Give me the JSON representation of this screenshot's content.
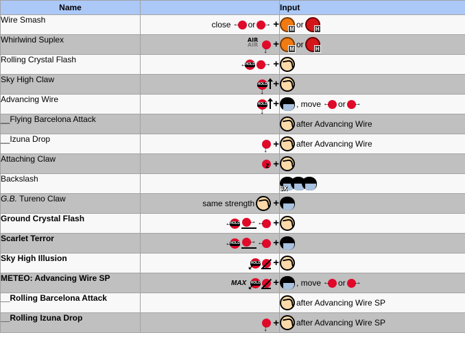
{
  "table": {
    "headers": {
      "name": "Name",
      "direction": "",
      "input": "Input"
    },
    "rows": [
      {
        "name": "Wire Smash",
        "style": "normal",
        "direction": {
          "prefix": "close",
          "sequence": [
            "back",
            "or",
            "forward"
          ]
        },
        "input": {
          "buttons": [
            "punch-medium",
            "or",
            "punch-heavy"
          ],
          "suffix": ""
        }
      },
      {
        "name": "Whirlwind Suplex",
        "style": "normal",
        "direction": {
          "prefix": "AIR",
          "sequence": [
            "down"
          ]
        },
        "input": {
          "buttons": [
            "punch-medium",
            "or",
            "punch-heavy"
          ],
          "suffix": ""
        }
      },
      {
        "name": "Rolling Crystal Flash",
        "style": "normal",
        "direction": {
          "prefix": "",
          "sequence": [
            "hold-back",
            "forward"
          ]
        },
        "input": {
          "buttons": [
            "punch"
          ],
          "suffix": ""
        }
      },
      {
        "name": "Sky High Claw",
        "style": "normal",
        "direction": {
          "prefix": "",
          "sequence": [
            "hold-down",
            "up"
          ]
        },
        "input": {
          "buttons": [
            "punch"
          ],
          "suffix": ""
        }
      },
      {
        "name": "Advancing Wire",
        "style": "normal",
        "direction": {
          "prefix": "",
          "sequence": [
            "hold-down",
            "up"
          ]
        },
        "input": {
          "buttons": [
            "kick"
          ],
          "suffix": ", move",
          "after": [
            "back",
            "or",
            "forward"
          ]
        }
      },
      {
        "name": "__Flying Barcelona Attack",
        "style": "normal",
        "direction": {
          "prefix": "",
          "sequence": []
        },
        "input": {
          "buttons": [
            "punch"
          ],
          "suffix": "after Advancing Wire"
        }
      },
      {
        "name": "__Izuna Drop",
        "style": "normal",
        "direction": {
          "prefix": "",
          "sequence": [
            "down"
          ]
        },
        "input": {
          "buttons": [
            "punch"
          ],
          "suffix": "after Advancing Wire"
        }
      },
      {
        "name": "Attaching Claw",
        "style": "normal",
        "direction": {
          "prefix": "",
          "sequence": [
            "z-motion"
          ]
        },
        "input": {
          "buttons": [
            "punch"
          ],
          "suffix": ""
        }
      },
      {
        "name": "Backslash",
        "style": "normal",
        "direction": {
          "prefix": "",
          "sequence": []
        },
        "input": {
          "buttons": [
            "kick-3x"
          ],
          "suffix": ""
        }
      },
      {
        "name": "G.B. Tureno Claw",
        "name_italic_part": "G.B.",
        "name_rest": " Tureno Claw",
        "style": "normal",
        "direction": {
          "prefix": "same strength",
          "sequence": [
            "punch-button"
          ]
        },
        "input": {
          "buttons": [
            "kick"
          ],
          "suffix": ""
        }
      },
      {
        "name": "Ground Crystal Flash",
        "style": "bold",
        "direction": {
          "prefix": "",
          "sequence": [
            "hold-back",
            "forward-charge",
            "back"
          ]
        },
        "input": {
          "buttons": [
            "punch"
          ],
          "suffix": ""
        }
      },
      {
        "name": "Scarlet Terror",
        "style": "bold",
        "direction": {
          "prefix": "",
          "sequence": [
            "hold-back",
            "forward-charge",
            "back"
          ]
        },
        "input": {
          "buttons": [
            "kick"
          ],
          "suffix": ""
        }
      },
      {
        "name": "Sky High Illusion",
        "style": "bold",
        "direction": {
          "prefix": "",
          "sequence": [
            "hold-down-back",
            "up-forward"
          ]
        },
        "input": {
          "buttons": [
            "punch"
          ],
          "suffix": ""
        }
      },
      {
        "name": "METEO: Advancing Wire SP",
        "style": "bold",
        "direction": {
          "prefix": "MAX",
          "sequence": [
            "hold-down-back",
            "up-forward"
          ]
        },
        "input": {
          "buttons": [
            "kick"
          ],
          "suffix": ", move",
          "after": [
            "back",
            "or",
            "forward"
          ]
        }
      },
      {
        "name": "__Rolling Barcelona Attack",
        "style": "bold",
        "direction": {
          "prefix": "",
          "sequence": []
        },
        "input": {
          "buttons": [
            "punch"
          ],
          "suffix": "after Advancing Wire SP"
        }
      },
      {
        "name": "__Rolling Izuna Drop",
        "style": "bold",
        "direction": {
          "prefix": "",
          "sequence": [
            "down"
          ]
        },
        "input": {
          "buttons": [
            "punch"
          ],
          "suffix": "after Advancing Wire SP"
        }
      }
    ]
  },
  "labels": {
    "or": "or",
    "close": "close",
    "air": "AIR",
    "max": "MAX",
    "x3": "3X",
    "m": "M",
    "h": "H",
    "same_strength": "same strength",
    "move": ", move"
  },
  "colors": {
    "header_bg": "#abc8f7",
    "row_odd": "#f8f8f8",
    "row_even": "#c0c0c0",
    "border": "#a2a2a2",
    "stick_ball": "#e0092a"
  }
}
